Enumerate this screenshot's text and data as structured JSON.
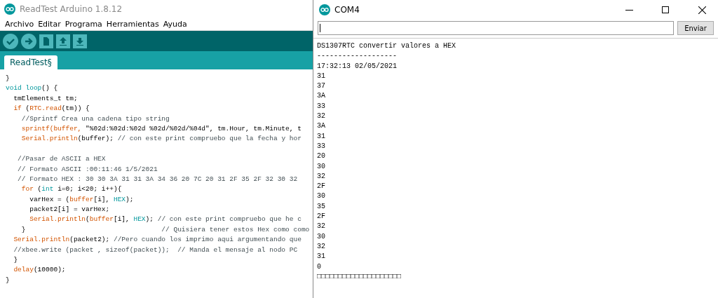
{
  "ide": {
    "title": "ReadTest Arduino 1.8.12",
    "menu": [
      "Archivo",
      "Editar",
      "Programa",
      "Herramientas",
      "Ayuda"
    ],
    "toolbar": [
      {
        "kind": "verify"
      },
      {
        "kind": "upload"
      },
      {
        "kind": "new"
      },
      {
        "kind": "open"
      },
      {
        "kind": "save"
      }
    ],
    "tabs": [
      {
        "label": "ReadTest§",
        "selected": true
      }
    ],
    "code": [
      {
        "kind": "code",
        "segs": [
          {
            "kind": "plain",
            "t": "}"
          }
        ]
      },
      {
        "kind": "code",
        "segs": [
          {
            "kind": "kw",
            "t": "void loop"
          },
          {
            "kind": "plain",
            "t": "() {"
          }
        ]
      },
      {
        "kind": "code",
        "segs": [
          {
            "kind": "plain",
            "t": "  tmElements_t tm;"
          }
        ]
      },
      {
        "kind": "code",
        "segs": [
          {
            "kind": "fn",
            "t": "  if"
          },
          {
            "kind": "plain",
            "t": " ("
          },
          {
            "kind": "fn",
            "t": "RTC.read"
          },
          {
            "kind": "plain",
            "t": "(tm)) {"
          }
        ]
      },
      {
        "kind": "code",
        "segs": [
          {
            "kind": "comment",
            "t": "    //Sprintf Crea una cadena tipo string"
          }
        ]
      },
      {
        "kind": "code",
        "segs": [
          {
            "kind": "fn",
            "t": "    sprintf(buffer,"
          },
          {
            "kind": "plain",
            "t": " \"%02d:%02d:%02d %02d/%02d/%04d\", tm.Hour, tm.Minute, t"
          }
        ]
      },
      {
        "kind": "code",
        "segs": [
          {
            "kind": "fn",
            "t": "    Serial.println"
          },
          {
            "kind": "plain",
            "t": "(buffer); "
          },
          {
            "kind": "comment",
            "t": "// con este print compruebo que la fecha y hor"
          }
        ]
      },
      {
        "kind": "blank"
      },
      {
        "kind": "code",
        "segs": [
          {
            "kind": "comment",
            "t": "   //Pasar de ASCII a HEX"
          }
        ]
      },
      {
        "kind": "code",
        "segs": [
          {
            "kind": "comment",
            "t": "   // Formato ASCII :00:11:46 1/5/2021"
          }
        ]
      },
      {
        "kind": "code",
        "segs": [
          {
            "kind": "comment",
            "t": "   // Formato HEX : 30 30 3A 31 31 3A 34 36 20 7C 20 31 2F 35 2F 32 30 32"
          }
        ]
      },
      {
        "kind": "code",
        "segs": [
          {
            "kind": "fn",
            "t": "    for"
          },
          {
            "kind": "plain",
            "t": " ("
          },
          {
            "kind": "kw",
            "t": "int"
          },
          {
            "kind": "plain",
            "t": " i=0; i<20; i++){"
          }
        ]
      },
      {
        "kind": "code",
        "segs": [
          {
            "kind": "plain",
            "t": "      varHex = ("
          },
          {
            "kind": "fn",
            "t": "buffer"
          },
          {
            "kind": "plain",
            "t": "[i], "
          },
          {
            "kind": "kw",
            "t": "HEX"
          },
          {
            "kind": "plain",
            "t": ");"
          }
        ]
      },
      {
        "kind": "code",
        "segs": [
          {
            "kind": "plain",
            "t": "      packet2[i] = varHex;"
          }
        ]
      },
      {
        "kind": "code",
        "segs": [
          {
            "kind": "fn",
            "t": "      Serial.println"
          },
          {
            "kind": "plain",
            "t": "("
          },
          {
            "kind": "fn",
            "t": "buffer"
          },
          {
            "kind": "plain",
            "t": "[i], "
          },
          {
            "kind": "kw",
            "t": "HEX"
          },
          {
            "kind": "plain",
            "t": "); "
          },
          {
            "kind": "comment",
            "t": "// con este print compruebo que he c"
          }
        ]
      },
      {
        "kind": "code",
        "segs": [
          {
            "kind": "plain",
            "t": "    }"
          },
          {
            "kind": "comment",
            "t": "                                  // Quisiera tener estos Hex como como"
          }
        ]
      },
      {
        "kind": "code",
        "segs": [
          {
            "kind": "fn",
            "t": "  Serial.println"
          },
          {
            "kind": "plain",
            "t": "(packet2); "
          },
          {
            "kind": "comment",
            "t": "//Pero cuando los imprimo aqui argumentando que"
          }
        ]
      },
      {
        "kind": "code",
        "segs": [
          {
            "kind": "comment",
            "t": "  //xbee.write (packet , sizeof(packet));  // Manda el mensaje al nodo PC"
          }
        ]
      },
      {
        "kind": "code",
        "segs": [
          {
            "kind": "plain",
            "t": "  }"
          }
        ]
      },
      {
        "kind": "code",
        "segs": [
          {
            "kind": "fn",
            "t": "  delay"
          },
          {
            "kind": "plain",
            "t": "(10000);"
          }
        ]
      },
      {
        "kind": "code",
        "segs": [
          {
            "kind": "plain",
            "t": "}"
          }
        ]
      }
    ]
  },
  "serial": {
    "title": "COM4",
    "send_label": "Enviar",
    "lines": [
      "DS1307RTC convertir valores a HEX",
      "-------------------",
      "17:32:13 02/05/2021",
      "31",
      "37",
      "3A",
      "33",
      "32",
      "3A",
      "31",
      "33",
      "20",
      "30",
      "32",
      "2F",
      "30",
      "35",
      "2F",
      "32",
      "30",
      "32",
      "31",
      "0",
      "□□□□□□□□□□□□□□□□□□□□"
    ]
  }
}
